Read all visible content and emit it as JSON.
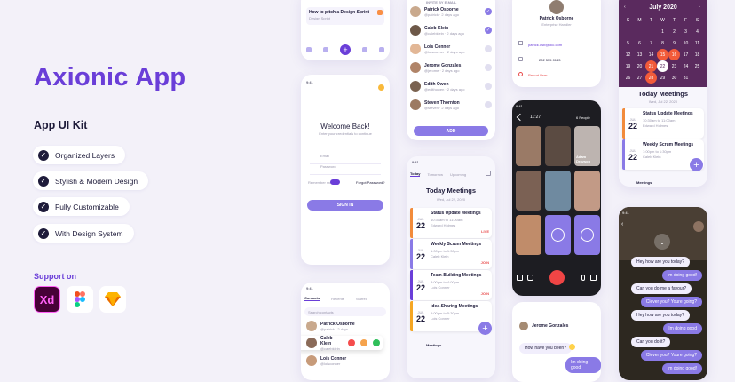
{
  "hero": {
    "title": "Axionic App",
    "subtitle": "App UI Kit",
    "features": [
      "Organized Layers",
      "Stylish & Modern Design",
      "Fully Customizable",
      "With Design System"
    ],
    "support_label": "Support on",
    "tools": [
      "Xd",
      "F",
      "S"
    ]
  },
  "login": {
    "time": "9:41",
    "heading": "Welcome Back!",
    "sub": "Enter your credentials to continue",
    "email_ph": "Email",
    "password_ph": "Password",
    "remember": "Remember me",
    "forgot": "Forgot Password?",
    "signin": "SIGN IN"
  },
  "task_top": {
    "title": "How to pitch a Design Sprint",
    "sub": "Design Sprint"
  },
  "contacts_list": {
    "header": "INVITE BY E-MAIL",
    "people": [
      {
        "name": "Patrick Osborne",
        "sub": "@patrick · 2 days ago"
      },
      {
        "name": "Caleb Klein",
        "sub": "@calebklein · 2 days ago"
      },
      {
        "name": "Lois Conner",
        "sub": "@loisconner · 2 days ago"
      },
      {
        "name": "Jerome Gonzales",
        "sub": "@jerome · 2 days ago"
      },
      {
        "name": "Edith Owen",
        "sub": "@edithowen · 2 days ago"
      },
      {
        "name": "Steven Thornton",
        "sub": "@steven · 2 days ago"
      }
    ],
    "add": "ADD"
  },
  "profile": {
    "name": "Patrick Osborne",
    "role": "Enterprise Handler",
    "email": "patrick.osb@ckc.com",
    "phone": "202 555 0143",
    "report": "Report User"
  },
  "calendar": {
    "month": "July 2020",
    "days": [
      "S",
      "M",
      "T",
      "W",
      "T",
      "F",
      "S"
    ],
    "weeks": [
      [
        "",
        "",
        "",
        "1",
        "2",
        "3",
        "4"
      ],
      [
        "5",
        "6",
        "7",
        "8",
        "9",
        "10",
        "11"
      ],
      [
        "12",
        "13",
        "14",
        "15",
        "16",
        "17",
        "18"
      ],
      [
        "19",
        "20",
        "21",
        "22",
        "23",
        "24",
        "25"
      ],
      [
        "26",
        "27",
        "28",
        "29",
        "30",
        "31",
        ""
      ]
    ],
    "meet_title": "Today Meetings",
    "meet_date": "Wed, Jul 22, 2020",
    "meetings": [
      {
        "title": "Status Update Meetings",
        "time": "10:30am to 11:00am",
        "who": "Edward Holmes",
        "m": "JUL",
        "d": "22"
      },
      {
        "title": "Weekly Scrum Meetings",
        "time": "1:00pm to 1:30pm",
        "who": "Caleb Klein",
        "m": "JUL",
        "d": "22"
      }
    ],
    "tab": "Meetings"
  },
  "meetings_screen": {
    "time": "9:41",
    "tabs": [
      "Today",
      "Tomorrow",
      "Upcoming"
    ],
    "title": "Today Meetings",
    "date": "Wed, Jul 22, 2020",
    "items": [
      {
        "title": "Status Update Meetings",
        "time": "10:30am to 11:00am",
        "who": "Edward Holmes",
        "m": "JUL",
        "d": "22",
        "tag": "LIVE"
      },
      {
        "title": "Weekly Scrum Meetings",
        "time": "1:00pm to 1:30pm",
        "who": "Caleb Klein",
        "m": "JUL",
        "d": "22",
        "tag": "JOIN"
      },
      {
        "title": "Team-Building Meetings",
        "time": "3:00pm to 4:00pm",
        "who": "Lois Conner",
        "m": "JUL",
        "d": "22",
        "tag": "JOIN"
      },
      {
        "title": "Idea-Sharing Meetings",
        "time": "5:00pm to 5:30pm",
        "who": "Lois Conner",
        "m": "JUL",
        "d": "22",
        "tag": "JOIN"
      }
    ],
    "nav": "Meetings"
  },
  "video": {
    "time": "11:27",
    "people": "6 People",
    "labels": [
      "Adam Drayson",
      "Alexa Bright"
    ]
  },
  "contacts_screen": {
    "time": "9:41",
    "tabs": [
      "Contacts",
      "Recents",
      "Starred"
    ],
    "search_ph": "Search contacts",
    "people": [
      {
        "name": "Patrick Osborne",
        "sub": "@patrick · 2 days"
      },
      {
        "name": "Caleb Klein",
        "sub": "@calebklein"
      },
      {
        "name": "Lois Conner",
        "sub": "@loisconner"
      }
    ]
  },
  "chat_small": {
    "name": "Jerome Gonzales",
    "msgs": [
      "How have you been?",
      "Im doing good"
    ]
  },
  "chat_dark": {
    "time": "9:41",
    "msgs": [
      "Hey how are you today?",
      "Im doing good!",
      "Can you do me a favour?",
      "Clever you? Youre going?",
      "Hey how are you today?",
      "Im doing good",
      "Can you do it?",
      "Clever you? Youre going?",
      "Im doing good!"
    ]
  }
}
